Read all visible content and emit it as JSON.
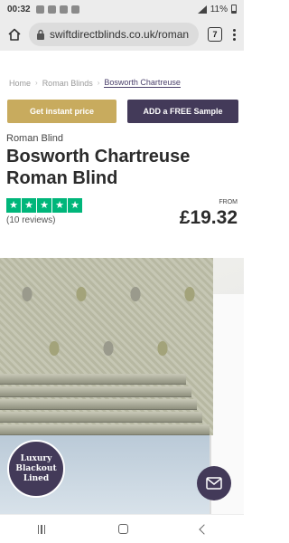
{
  "status": {
    "time": "00:32",
    "battery": "11%"
  },
  "browser": {
    "url": "swiftdirectblinds.co.uk/roman",
    "tab_count": "7"
  },
  "breadcrumb": {
    "items": [
      "Home",
      "Roman Blinds",
      "Bosworth Chartreuse"
    ]
  },
  "actions": {
    "instant_price": "Get instant price",
    "free_sample": "ADD a FREE Sample"
  },
  "product": {
    "category": "Roman Blind",
    "title": "Bosworth Chartreuse Roman Blind",
    "rating_stars": 5,
    "reviews": "(10 reviews)",
    "from_label": "FROM",
    "price": "£19.32"
  },
  "badge": {
    "line1": "Luxury",
    "line2": "Blackout",
    "line3": "Lined"
  },
  "icons": {
    "home": "home-icon",
    "lock": "lock-icon",
    "menu": "more-vert-icon",
    "chat": "mail-icon"
  },
  "colors": {
    "gold": "#c8ab5e",
    "purple": "#433a59",
    "trustpilot_green": "#00b67a"
  }
}
